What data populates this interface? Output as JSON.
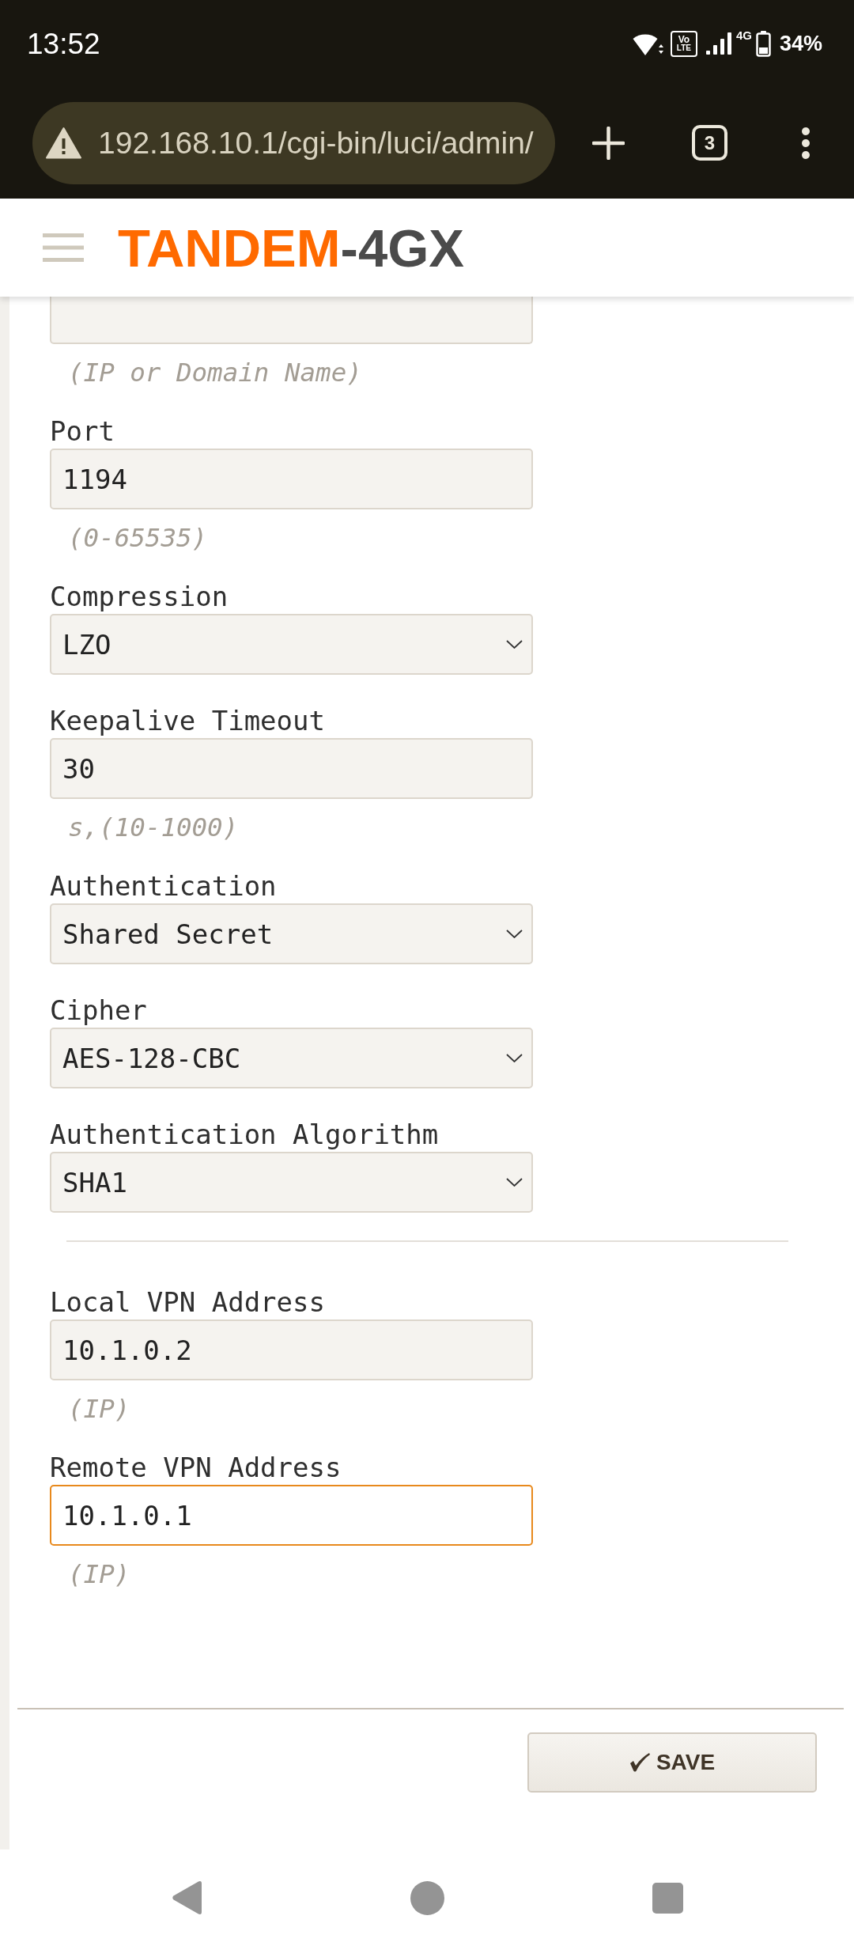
{
  "status_bar": {
    "time": "13:52",
    "volte": [
      "Vo",
      "LTE"
    ],
    "network": "4G",
    "battery": "34%"
  },
  "browser": {
    "url": "192.168.10.1/cgi-bin/luci/admin/",
    "tab_count": "3"
  },
  "header": {
    "logo": {
      "primary": "TANDEM",
      "secondary": "-4GX"
    }
  },
  "form": {
    "sections": [
      {
        "fields": [
          {
            "kind": "text",
            "focused": false,
            "hint": "(IP or Domain Name)"
          },
          {
            "kind": "text",
            "label": "Port",
            "value": "1194",
            "focused": false,
            "hint": "(0-65535)"
          },
          {
            "kind": "select",
            "label": "Compression",
            "value": "LZO",
            "focused": false
          },
          {
            "kind": "text",
            "label": "Keepalive Timeout",
            "value": "30",
            "focused": false,
            "hint": "s,(10-1000)"
          },
          {
            "kind": "select",
            "label": "Authentication",
            "value": "Shared Secret",
            "focused": false
          },
          {
            "kind": "select",
            "label": "Cipher",
            "value": "AES-128-CBC",
            "focused": false
          },
          {
            "kind": "select",
            "label": "Authentication Algorithm",
            "value": "SHA1",
            "focused": false
          }
        ]
      },
      {
        "fields": [
          {
            "kind": "text",
            "label": "Local VPN Address",
            "value": "10.1.0.2",
            "focused": false,
            "hint": "(IP)"
          },
          {
            "kind": "text",
            "label": "Remote VPN Address",
            "value": "10.1.0.1",
            "focused": true,
            "hint": "(IP)"
          }
        ]
      }
    ]
  },
  "actions": {
    "save": "SAVE"
  }
}
